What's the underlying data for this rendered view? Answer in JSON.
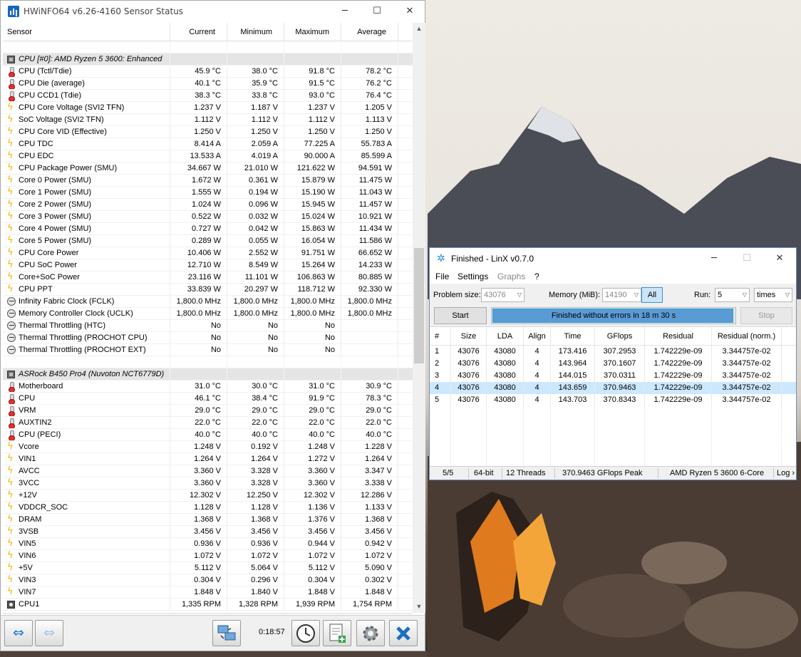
{
  "colors": {
    "accent": "#1c78d6",
    "progress": "#5b9bd5",
    "selected_row": "#cce8ff",
    "bolt": "#f0b400"
  },
  "hwinfo": {
    "title": "HWiNFO64 v6.26-4160 Sensor Status",
    "columns": [
      "Sensor",
      "Current",
      "Minimum",
      "Maximum",
      "Average"
    ],
    "rows": [
      {
        "type": "blank"
      },
      {
        "type": "group",
        "icon": "chip-icon",
        "name": "CPU [#0]: AMD Ryzen 5 3600: Enhanced"
      },
      {
        "icon": "thermometer-icon",
        "name": "CPU (Tctl/Tdie)",
        "cur": "45.9 °C",
        "min": "38.0 °C",
        "max": "91.8 °C",
        "avg": "78.2 °C"
      },
      {
        "icon": "thermometer-icon",
        "name": "CPU Die (average)",
        "cur": "40.1 °C",
        "min": "35.9 °C",
        "max": "91.5 °C",
        "avg": "76.2 °C"
      },
      {
        "icon": "thermometer-icon",
        "name": "CPU CCD1 (Tdie)",
        "cur": "38.3 °C",
        "min": "33.8 °C",
        "max": "93.0 °C",
        "avg": "76.4 °C"
      },
      {
        "icon": "lightning-icon",
        "name": "CPU Core Voltage (SVI2 TFN)",
        "cur": "1.237 V",
        "min": "1.187 V",
        "max": "1.237 V",
        "avg": "1.205 V"
      },
      {
        "icon": "lightning-icon",
        "name": "SoC Voltage (SVI2 TFN)",
        "cur": "1.112 V",
        "min": "1.112 V",
        "max": "1.112 V",
        "avg": "1.113 V"
      },
      {
        "icon": "lightning-icon",
        "name": "CPU Core VID (Effective)",
        "cur": "1.250 V",
        "min": "1.250 V",
        "max": "1.250 V",
        "avg": "1.250 V"
      },
      {
        "icon": "lightning-icon",
        "name": "CPU TDC",
        "cur": "8.414 A",
        "min": "2.059 A",
        "max": "77.225 A",
        "avg": "55.783 A"
      },
      {
        "icon": "lightning-icon",
        "name": "CPU EDC",
        "cur": "13.533 A",
        "min": "4.019 A",
        "max": "90.000 A",
        "avg": "85.599 A"
      },
      {
        "icon": "lightning-icon",
        "name": "CPU Package Power (SMU)",
        "cur": "34.667 W",
        "min": "21.010 W",
        "max": "121.622 W",
        "avg": "94.591 W"
      },
      {
        "icon": "lightning-icon",
        "name": "Core 0 Power (SMU)",
        "cur": "1.672 W",
        "min": "0.361 W",
        "max": "15.879 W",
        "avg": "11.475 W"
      },
      {
        "icon": "lightning-icon",
        "name": "Core 1 Power (SMU)",
        "cur": "1.555 W",
        "min": "0.194 W",
        "max": "15.190 W",
        "avg": "11.043 W"
      },
      {
        "icon": "lightning-icon",
        "name": "Core 2 Power (SMU)",
        "cur": "1.024 W",
        "min": "0.096 W",
        "max": "15.945 W",
        "avg": "11.457 W"
      },
      {
        "icon": "lightning-icon",
        "name": "Core 3 Power (SMU)",
        "cur": "0.522 W",
        "min": "0.032 W",
        "max": "15.024 W",
        "avg": "10.921 W"
      },
      {
        "icon": "lightning-icon",
        "name": "Core 4 Power (SMU)",
        "cur": "0.727 W",
        "min": "0.042 W",
        "max": "15.863 W",
        "avg": "11.434 W"
      },
      {
        "icon": "lightning-icon",
        "name": "Core 5 Power (SMU)",
        "cur": "0.289 W",
        "min": "0.055 W",
        "max": "16.054 W",
        "avg": "11.586 W"
      },
      {
        "icon": "lightning-icon",
        "name": "CPU Core Power",
        "cur": "10.406 W",
        "min": "2.552 W",
        "max": "91.751 W",
        "avg": "66.652 W"
      },
      {
        "icon": "lightning-icon",
        "name": "CPU SoC Power",
        "cur": "12.710 W",
        "min": "8.549 W",
        "max": "15.264 W",
        "avg": "14.233 W"
      },
      {
        "icon": "lightning-icon",
        "name": "Core+SoC Power",
        "cur": "23.116 W",
        "min": "11.101 W",
        "max": "106.863 W",
        "avg": "80.885 W"
      },
      {
        "icon": "lightning-icon",
        "name": "CPU PPT",
        "cur": "33.839 W",
        "min": "20.297 W",
        "max": "118.712 W",
        "avg": "92.330 W"
      },
      {
        "icon": "gauge-icon",
        "name": "Infinity Fabric Clock (FCLK)",
        "cur": "1,800.0 MHz",
        "min": "1,800.0 MHz",
        "max": "1,800.0 MHz",
        "avg": "1,800.0 MHz"
      },
      {
        "icon": "gauge-icon",
        "name": "Memory Controller Clock (UCLK)",
        "cur": "1,800.0 MHz",
        "min": "1,800.0 MHz",
        "max": "1,800.0 MHz",
        "avg": "1,800.0 MHz"
      },
      {
        "icon": "gauge-icon",
        "name": "Thermal Throttling (HTC)",
        "cur": "No",
        "min": "No",
        "max": "No",
        "avg": ""
      },
      {
        "icon": "gauge-icon",
        "name": "Thermal Throttling (PROCHOT CPU)",
        "cur": "No",
        "min": "No",
        "max": "No",
        "avg": ""
      },
      {
        "icon": "gauge-icon",
        "name": "Thermal Throttling (PROCHOT EXT)",
        "cur": "No",
        "min": "No",
        "max": "No",
        "avg": ""
      },
      {
        "type": "blank"
      },
      {
        "type": "group",
        "icon": "chip-icon",
        "name": "ASRock B450 Pro4 (Nuvoton NCT6779D)"
      },
      {
        "icon": "thermometer-icon",
        "name": "Motherboard",
        "cur": "31.0 °C",
        "min": "30.0 °C",
        "max": "31.0 °C",
        "avg": "30.9 °C"
      },
      {
        "icon": "thermometer-icon",
        "name": "CPU",
        "cur": "46.1 °C",
        "min": "38.4 °C",
        "max": "91.9 °C",
        "avg": "78.3 °C"
      },
      {
        "icon": "thermometer-icon",
        "name": "VRM",
        "cur": "29.0 °C",
        "min": "29.0 °C",
        "max": "29.0 °C",
        "avg": "29.0 °C"
      },
      {
        "icon": "thermometer-icon",
        "name": "AUXTIN2",
        "cur": "22.0 °C",
        "min": "22.0 °C",
        "max": "22.0 °C",
        "avg": "22.0 °C"
      },
      {
        "icon": "thermometer-icon",
        "name": "CPU (PECI)",
        "cur": "40.0 °C",
        "min": "40.0 °C",
        "max": "40.0 °C",
        "avg": "40.0 °C"
      },
      {
        "icon": "lightning-icon",
        "name": "Vcore",
        "cur": "1.248 V",
        "min": "0.192 V",
        "max": "1.248 V",
        "avg": "1.228 V"
      },
      {
        "icon": "lightning-icon",
        "name": "VIN1",
        "cur": "1.264 V",
        "min": "1.264 V",
        "max": "1.272 V",
        "avg": "1.264 V"
      },
      {
        "icon": "lightning-icon",
        "name": "AVCC",
        "cur": "3.360 V",
        "min": "3.328 V",
        "max": "3.360 V",
        "avg": "3.347 V"
      },
      {
        "icon": "lightning-icon",
        "name": "3VCC",
        "cur": "3.360 V",
        "min": "3.328 V",
        "max": "3.360 V",
        "avg": "3.338 V"
      },
      {
        "icon": "lightning-icon",
        "name": "+12V",
        "cur": "12.302 V",
        "min": "12.250 V",
        "max": "12.302 V",
        "avg": "12.286 V"
      },
      {
        "icon": "lightning-icon",
        "name": "VDDCR_SOC",
        "cur": "1.128 V",
        "min": "1.128 V",
        "max": "1.136 V",
        "avg": "1.133 V"
      },
      {
        "icon": "lightning-icon",
        "name": "DRAM",
        "cur": "1.368 V",
        "min": "1.368 V",
        "max": "1.376 V",
        "avg": "1.368 V"
      },
      {
        "icon": "lightning-icon",
        "name": "3VSB",
        "cur": "3.456 V",
        "min": "3.456 V",
        "max": "3.456 V",
        "avg": "3.456 V"
      },
      {
        "icon": "lightning-icon",
        "name": "VIN5",
        "cur": "0.936 V",
        "min": "0.936 V",
        "max": "0.944 V",
        "avg": "0.942 V"
      },
      {
        "icon": "lightning-icon",
        "name": "VIN6",
        "cur": "1.072 V",
        "min": "1.072 V",
        "max": "1.072 V",
        "avg": "1.072 V"
      },
      {
        "icon": "lightning-icon",
        "name": "+5V",
        "cur": "5.112 V",
        "min": "5.064 V",
        "max": "5.112 V",
        "avg": "5.090 V"
      },
      {
        "icon": "lightning-icon",
        "name": "VIN3",
        "cur": "0.304 V",
        "min": "0.296 V",
        "max": "0.304 V",
        "avg": "0.302 V"
      },
      {
        "icon": "lightning-icon",
        "name": "VIN7",
        "cur": "1.848 V",
        "min": "1.840 V",
        "max": "1.848 V",
        "avg": "1.848 V"
      },
      {
        "icon": "fan-icon",
        "name": "CPU1",
        "cur": "1,335 RPM",
        "min": "1,328 RPM",
        "max": "1,939 RPM",
        "avg": "1,754 RPM"
      }
    ],
    "toolbar": {
      "elapsed": "0:18:57"
    }
  },
  "linx": {
    "title": "Finished - LinX v0.7.0",
    "menu": {
      "file": "File",
      "settings": "Settings",
      "graphs": "Graphs",
      "help": "?"
    },
    "problem_size_label": "Problem size:",
    "problem_size": "43076",
    "memory_label": "Memory (MiB):",
    "memory": "14190",
    "all_label": "All",
    "run_label": "Run:",
    "run_value": "5",
    "run_unit": "times",
    "start_label": "Start",
    "stop_label": "Stop",
    "progress_text": "Finished without errors in 18 m 30 s",
    "progress_fraction": 1.0,
    "columns": [
      "#",
      "Size",
      "LDA",
      "Align",
      "Time",
      "GFlops",
      "Residual",
      "Residual (norm.)"
    ],
    "results": [
      {
        "n": "1",
        "size": "43076",
        "lda": "43080",
        "align": "4",
        "time": "173.416",
        "gflops": "307.2953",
        "residual": "1.742229e-09",
        "norm": "3.344757e-02"
      },
      {
        "n": "2",
        "size": "43076",
        "lda": "43080",
        "align": "4",
        "time": "143.964",
        "gflops": "370.1607",
        "residual": "1.742229e-09",
        "norm": "3.344757e-02"
      },
      {
        "n": "3",
        "size": "43076",
        "lda": "43080",
        "align": "4",
        "time": "144.015",
        "gflops": "370.0311",
        "residual": "1.742229e-09",
        "norm": "3.344757e-02"
      },
      {
        "n": "4",
        "size": "43076",
        "lda": "43080",
        "align": "4",
        "time": "143.659",
        "gflops": "370.9463",
        "residual": "1.742229e-09",
        "norm": "3.344757e-02",
        "selected": true
      },
      {
        "n": "5",
        "size": "43076",
        "lda": "43080",
        "align": "4",
        "time": "143.703",
        "gflops": "370.8343",
        "residual": "1.742229e-09",
        "norm": "3.344757e-02"
      }
    ],
    "status": {
      "runs": "5/5",
      "bits": "64-bit",
      "threads": "12 Threads",
      "peak": "370.9463 GFlops Peak",
      "cpu": "AMD Ryzen 5 3600 6-Core",
      "log": "Log ›"
    }
  }
}
